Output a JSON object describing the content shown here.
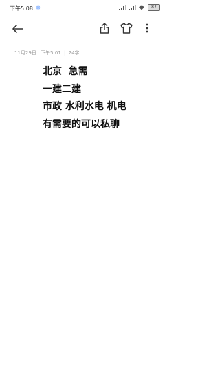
{
  "status_bar": {
    "time": "下午5:08",
    "battery": "87"
  },
  "toolbar": {
    "back_icon": "arrow-left-icon",
    "share_icon": "share-icon",
    "theme_icon": "tshirt-icon",
    "more_icon": "more-vertical-icon"
  },
  "note": {
    "date": "11月29日",
    "time": "下午5:01",
    "separator": "|",
    "char_count": "24字",
    "lines": [
      "北京  急需",
      "一建二建",
      "市政 水利水电 机电",
      "有需要的可以私聊"
    ]
  }
}
